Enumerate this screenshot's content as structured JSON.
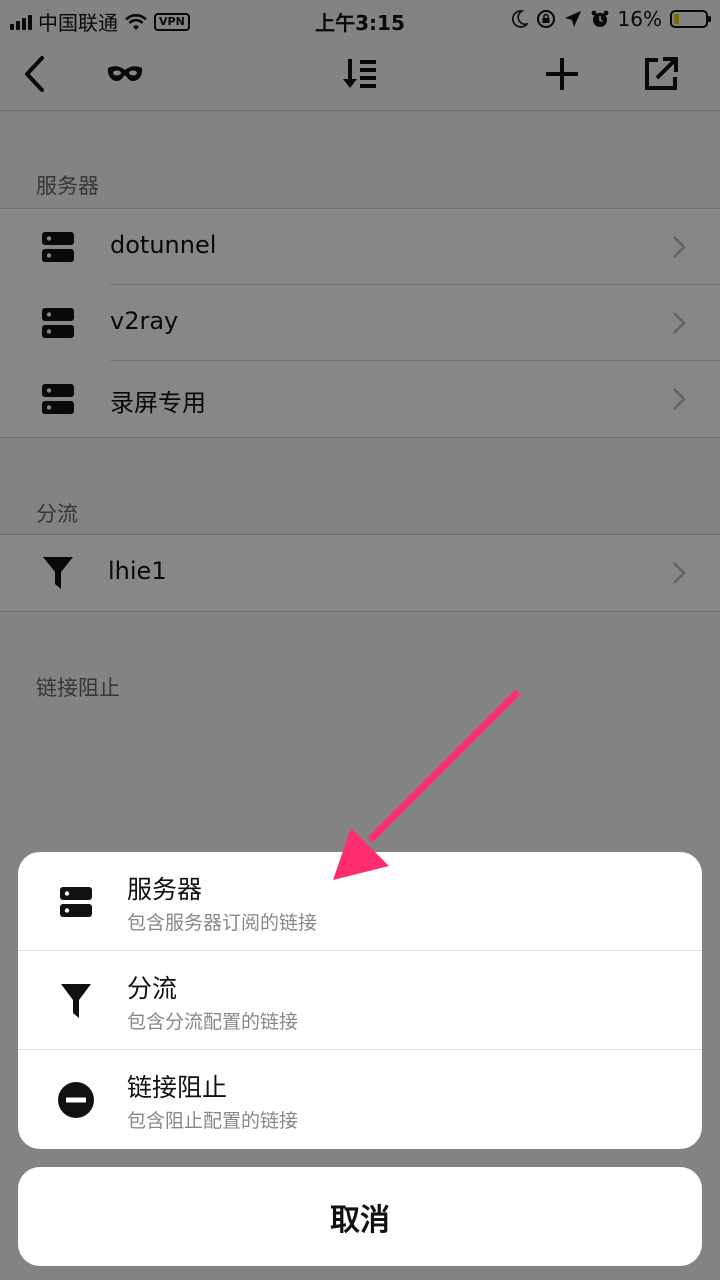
{
  "status_bar": {
    "carrier": "中国联通",
    "vpn": "VPN",
    "time": "上午3:15",
    "battery": "16%",
    "battery_level": 0.16
  },
  "nav": {
    "back_icon": "chevron-left-icon",
    "mask_icon": "mask-icon",
    "sort_icon": "sort-list-icon",
    "add_icon": "plus-icon",
    "share_icon": "external-link-icon"
  },
  "sections": {
    "servers": {
      "title": "服务器",
      "items": [
        {
          "label": "dotunnel"
        },
        {
          "label": "v2ray"
        },
        {
          "label": "录屏专用"
        }
      ]
    },
    "routing": {
      "title": "分流",
      "items": [
        {
          "label": "lhie1"
        }
      ]
    },
    "block": {
      "title": "链接阻止"
    }
  },
  "action_sheet": {
    "items": [
      {
        "title": "服务器",
        "subtitle": "包含服务器订阅的链接",
        "icon": "server-icon"
      },
      {
        "title": "分流",
        "subtitle": "包含分流配置的链接",
        "icon": "funnel-icon"
      },
      {
        "title": "链接阻止",
        "subtitle": "包含阻止配置的链接",
        "icon": "minus-circle-icon"
      }
    ],
    "cancel": "取消"
  },
  "colors": {
    "annotation_arrow": "#ff2d6f",
    "overlay": "rgba(0,0,0,0.47)"
  }
}
